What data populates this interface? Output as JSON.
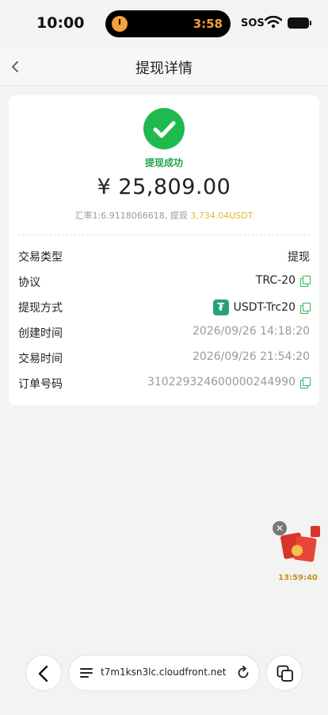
{
  "status_bar": {
    "time": "10:00",
    "island_time": "3:58",
    "sos": "SOS"
  },
  "header": {
    "title": "提现详情"
  },
  "summary": {
    "status": "提现成功",
    "amount": "¥ 25,809.00",
    "rate_prefix": "汇率1:6.9118066618, 提现 ",
    "rate_highlight": "3,734.04USDT"
  },
  "details": [
    {
      "label": "交易类型",
      "value": "提现"
    },
    {
      "label": "协议",
      "value": "TRC-20"
    },
    {
      "label": "提现方式",
      "value": "USDT-Trc20"
    },
    {
      "label": "创建时间",
      "value": "2026/09/26 14:18:20"
    },
    {
      "label": "交易时间",
      "value": "2026/09/26 21:54:20"
    },
    {
      "label": "订单号码",
      "value": "3102293246000002449​90"
    }
  ],
  "promo": {
    "countdown": "13:59:40"
  },
  "browser": {
    "url": "t7m1ksn3lc.cloudfront.net"
  },
  "colors": {
    "success": "#1fb94e",
    "highlight": "#e6b43c",
    "copy_icon": "#33b25b"
  }
}
